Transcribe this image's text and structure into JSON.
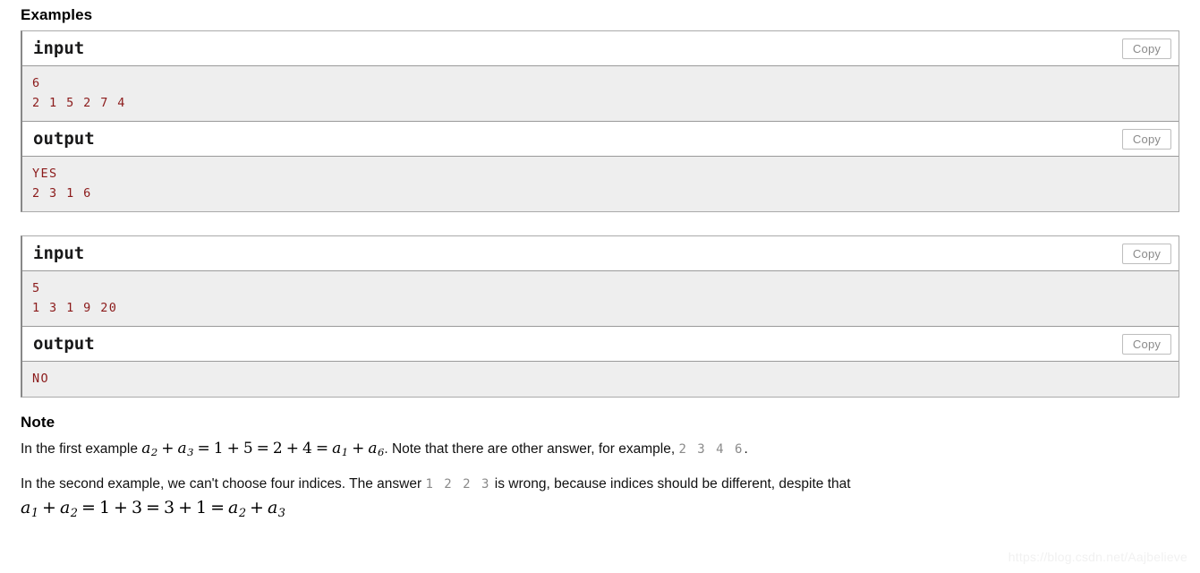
{
  "sections": {
    "examples_title": "Examples",
    "note_title": "Note"
  },
  "copy_label": "Copy",
  "examples": [
    {
      "input_label": "input",
      "input_text": "6\n2 1 5 2 7 4",
      "output_label": "output",
      "output_text": "YES\n2 3 1 6"
    },
    {
      "input_label": "input",
      "input_text": "5\n1 3 1 9 20",
      "output_label": "output",
      "output_text": "NO"
    }
  ],
  "note": {
    "p1": {
      "lead": "In the first example ",
      "math": {
        "t1": "a",
        "s1": "2",
        "plus1": "+",
        "t2": "a",
        "s2": "3",
        "eq1": "=",
        "n1": "1",
        "plus2": "+",
        "n2": "5",
        "eq2": "=",
        "n3": "2",
        "plus3": "+",
        "n4": "4",
        "eq3": "=",
        "t3": "a",
        "s3": "1",
        "plus4": "+",
        "t4": "a",
        "s4": "6"
      },
      "mid": ". Note that there are other answer, for example, ",
      "tt": "2  3  4  6",
      "tail": "."
    },
    "p2": {
      "lead": "In the second example, we can't choose four indices. The answer ",
      "tt": "1  2  2  3",
      "tail": " is wrong, because indices should be different, despite that",
      "math": {
        "t1": "a",
        "s1": "1",
        "plus1": "+",
        "t2": "a",
        "s2": "2",
        "eq1": "=",
        "n1": "1",
        "plus2": "+",
        "n2": "3",
        "eq2": "=",
        "n3": "3",
        "plus3": "+",
        "n4": "1",
        "eq3": "=",
        "t3": "a",
        "s3": "2",
        "plus4": "+",
        "t4": "a",
        "s4": "3"
      }
    }
  },
  "watermark": "https://blog.csdn.net/Aajbelieve"
}
